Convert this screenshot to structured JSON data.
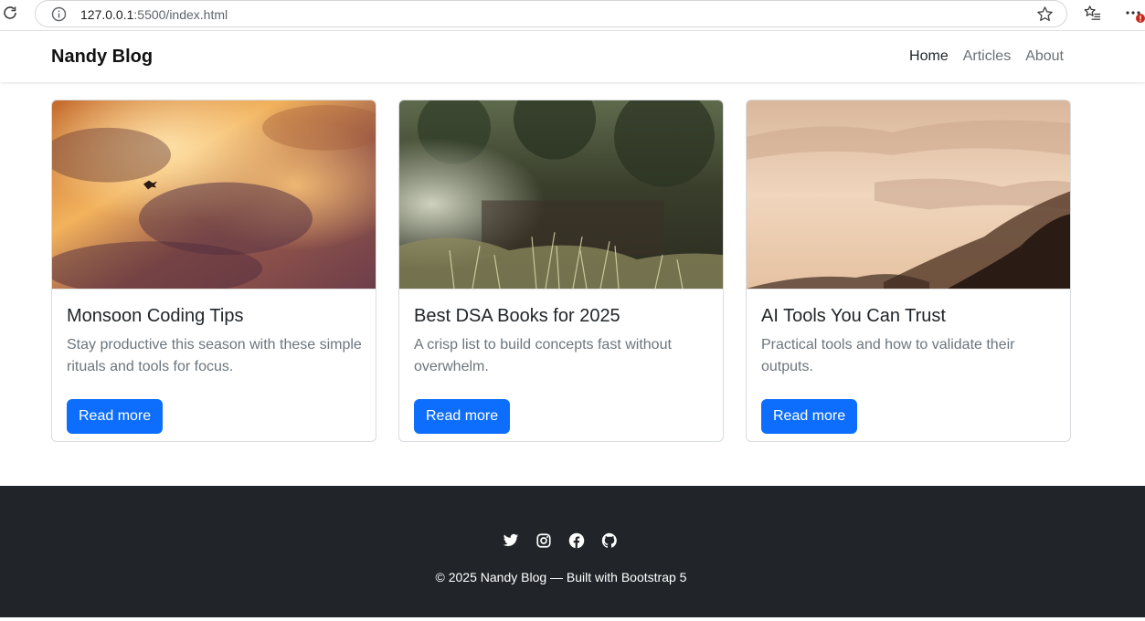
{
  "browser": {
    "url_host": "127.0.0.1",
    "url_rest": ":5500/index.html",
    "menu_badge": "!"
  },
  "navbar": {
    "brand": "Nandy Blog",
    "links": [
      "Home",
      "Articles",
      "About"
    ],
    "active_link": "Home"
  },
  "cards": [
    {
      "title": "Monsoon Coding Tips",
      "text": "Stay productive this season with these simple rituals and tools for focus.",
      "button": "Read more",
      "image": "sunset-clouds-bird"
    },
    {
      "title": "Best DSA Books for 2025",
      "text": "A crisp list to build concepts fast without overwhelm.",
      "button": "Read more",
      "image": "grass-steps-trees"
    },
    {
      "title": "AI Tools You Can Trust",
      "text": "Practical tools and how to validate their outputs.",
      "button": "Read more",
      "image": "misty-mountains"
    }
  ],
  "footer": {
    "social_icons": [
      "twitter-icon",
      "instagram-icon",
      "facebook-icon",
      "github-icon"
    ],
    "copyright": "© 2025 Nandy Blog — Built with Bootstrap 5"
  },
  "colors": {
    "primary": "#0d6efd",
    "footer_bg": "#212529",
    "muted_text": "#6c757d"
  }
}
